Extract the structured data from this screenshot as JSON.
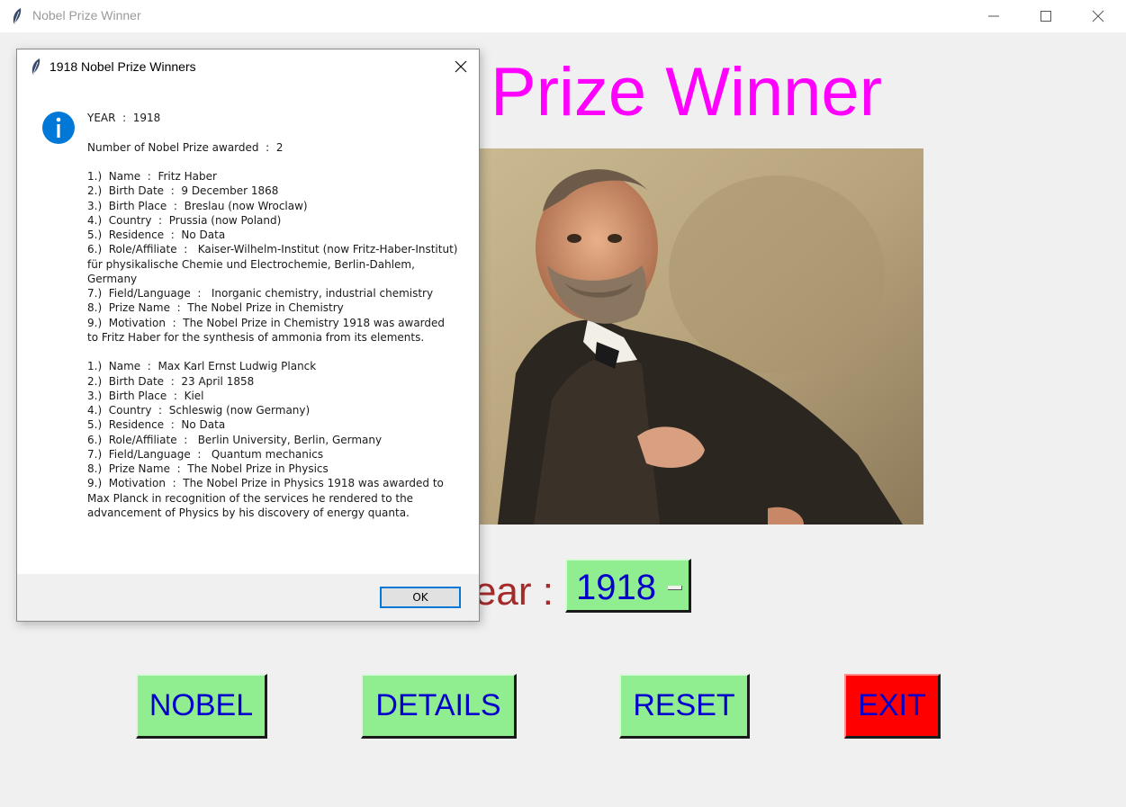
{
  "window": {
    "title": "Nobel Prize Winner",
    "controls": [
      "minimize",
      "maximize",
      "close"
    ]
  },
  "main": {
    "heading": "Prize Winner",
    "year_label": "ear :",
    "year_value": "1918",
    "buttons": {
      "nobel": "NOBEL",
      "details": "DETAILS",
      "reset": "RESET",
      "exit": "EXIT"
    }
  },
  "dialog": {
    "title": "1918 Nobel Prize Winners",
    "ok_label": "OK",
    "year_line": "YEAR  :  1918",
    "count_line": "Number of Nobel Prize awarded  :  2",
    "winners": [
      {
        "lines": [
          "1.)  Name  :  Fritz Haber",
          "2.)  Birth Date  :  9 December 1868",
          "3.)  Birth Place  :  Breslau (now Wroclaw)",
          "4.)  Country  :  Prussia (now Poland)",
          "5.)  Residence  :  No Data",
          "6.)  Role/Affiliate  :   Kaiser-Wilhelm-Institut (now Fritz-Haber-Institut) für physikalische Chemie und Electrochemie, Berlin-Dahlem, Germany",
          "7.)  Field/Language  :   Inorganic chemistry, industrial chemistry",
          "8.)  Prize Name  :  The Nobel Prize in Chemistry",
          "9.)  Motivation  :  The Nobel Prize in Chemistry 1918 was awarded to Fritz Haber for the synthesis of ammonia from its elements."
        ]
      },
      {
        "lines": [
          "1.)  Name  :  Max Karl Ernst Ludwig Planck",
          "2.)  Birth Date  :  23 April 1858",
          "3.)  Birth Place  :  Kiel",
          "4.)  Country  :  Schleswig (now Germany)",
          "5.)  Residence  :  No Data",
          "6.)  Role/Affiliate  :   Berlin University, Berlin, Germany",
          "7.)  Field/Language  :   Quantum mechanics",
          "8.)  Prize Name  :  The Nobel Prize in Physics",
          "9.)  Motivation  :  The Nobel Prize in Physics 1918 was awarded to Max Planck in recognition of the services he rendered to the advancement of Physics by his discovery of energy quanta."
        ]
      }
    ]
  },
  "colors": {
    "heading": "#ff00ff",
    "year_label": "#a52a2a",
    "button_bg": "#90ee90",
    "button_text": "#0000cd",
    "exit_bg": "#ff0000",
    "info_icon": "#0078d7"
  }
}
